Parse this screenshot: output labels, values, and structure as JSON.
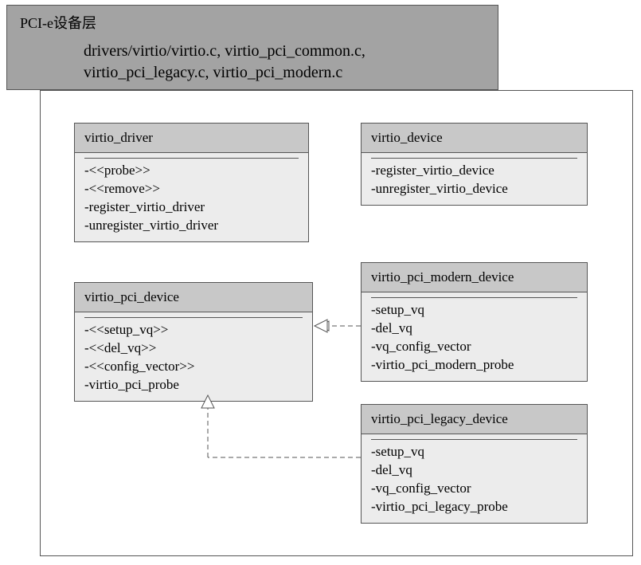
{
  "header": {
    "title": "PCI-e设备层",
    "files_line1": "drivers/virtio/virtio.c, virtio_pci_common.c,",
    "files_line2": "virtio_pci_legacy.c, virtio_pci_modern.c"
  },
  "classes": {
    "virtio_driver": {
      "name": "virtio_driver",
      "items": [
        "-<<probe>>",
        "-<<remove>>",
        "-register_virtio_driver",
        "-unregister_virtio_driver"
      ]
    },
    "virtio_device": {
      "name": "virtio_device",
      "items": [
        "-register_virtio_device",
        "-unregister_virtio_device"
      ]
    },
    "virtio_pci_device": {
      "name": "virtio_pci_device",
      "items": [
        "-<<setup_vq>>",
        "-<<del_vq>>",
        "-<<config_vector>>",
        "-virtio_pci_probe"
      ]
    },
    "virtio_pci_modern": {
      "name": "virtio_pci_modern_device",
      "items": [
        "-setup_vq",
        "-del_vq",
        "-vq_config_vector",
        "-virtio_pci_modern_probe"
      ]
    },
    "virtio_pci_legacy": {
      "name": "virtio_pci_legacy_device",
      "items": [
        "-setup_vq",
        "-del_vq",
        "-vq_config_vector",
        "-virtio_pci_legacy_probe"
      ]
    }
  }
}
